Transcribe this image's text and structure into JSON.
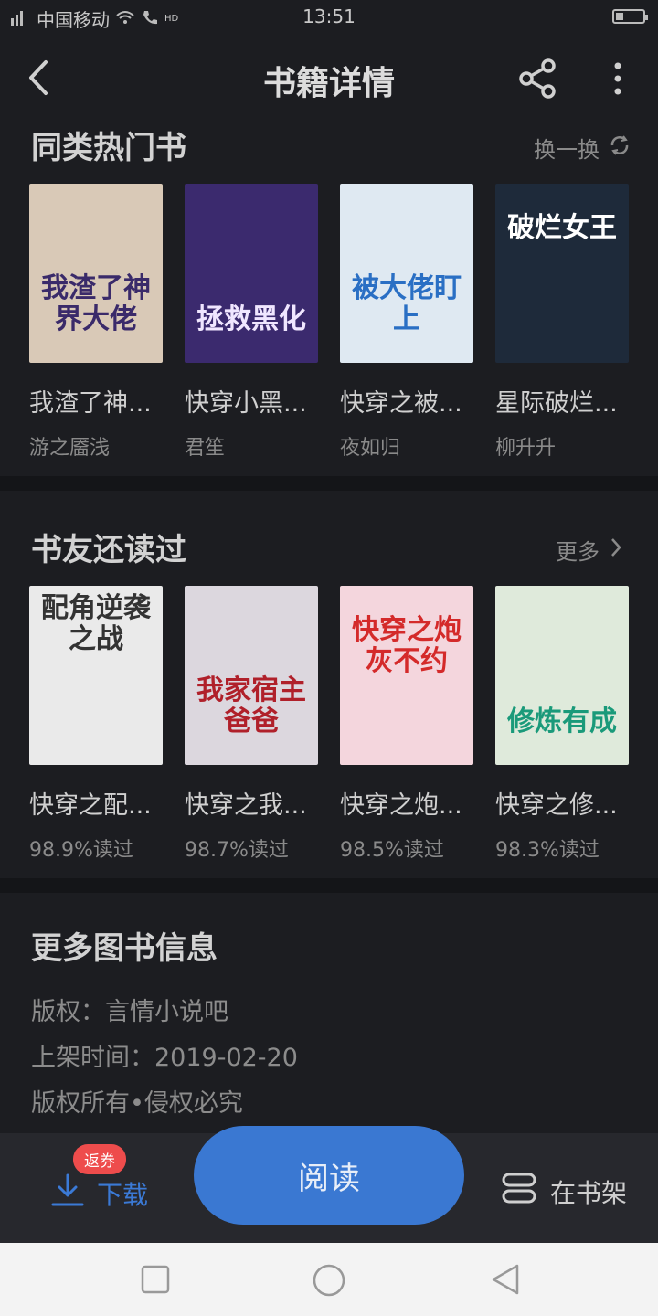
{
  "status_bar": {
    "carrier": "中国移动",
    "time": "13:51",
    "hd": "HD"
  },
  "header": {
    "title": "书籍详情",
    "back_icon": "back-arrow-icon",
    "share_icon": "share-icon",
    "more_icon": "more-vertical-icon"
  },
  "similar": {
    "title": "同类热门书",
    "action_label": "换一换",
    "books": [
      {
        "name": "我渣了神...",
        "author": "游之靥浅",
        "cover_text": "我渣了神界大佬",
        "cover_bg": "#d9c9b7"
      },
      {
        "name": "快穿小黑...",
        "author": "君笙",
        "cover_text": "拯救黑化",
        "cover_bg": "#3b2a6e"
      },
      {
        "name": "快穿之被...",
        "author": "夜如归",
        "cover_text": "被大佬盯上",
        "cover_bg": "#dfe9f2"
      },
      {
        "name": "星际破烂...",
        "author": "柳升升",
        "cover_text": "破烂女王",
        "cover_bg": "#1e2a3a"
      }
    ]
  },
  "also_read": {
    "title": "书友还读过",
    "action_label": "更多",
    "books": [
      {
        "name": "快穿之配...",
        "stat": "98.9%读过",
        "cover_text": "配角逆袭之战",
        "cover_bg": "#eaeaea"
      },
      {
        "name": "快穿之我...",
        "stat": "98.7%读过",
        "cover_text": "我家宿主爸爸",
        "cover_bg": "#dcd7de"
      },
      {
        "name": "快穿之炮...",
        "stat": "98.5%读过",
        "cover_text": "快穿之炮灰不约",
        "cover_bg": "#f4d6dd"
      },
      {
        "name": "快穿之修...",
        "stat": "98.3%读过",
        "cover_text": "修炼有成",
        "cover_bg": "#dfeadb"
      }
    ]
  },
  "more_info": {
    "title": "更多图书信息",
    "copyright": "版权：言情小说吧",
    "release_date": "上架时间：2019-02-20",
    "rights": "版权所有•侵权必究"
  },
  "bottom_bar": {
    "download_label": "下载",
    "badge": "返券",
    "read_label": "阅读",
    "shelf_label": "在书架"
  },
  "colors": {
    "accent": "#3a78d2",
    "badge": "#ee4c4c",
    "background": "#1c1d21"
  }
}
